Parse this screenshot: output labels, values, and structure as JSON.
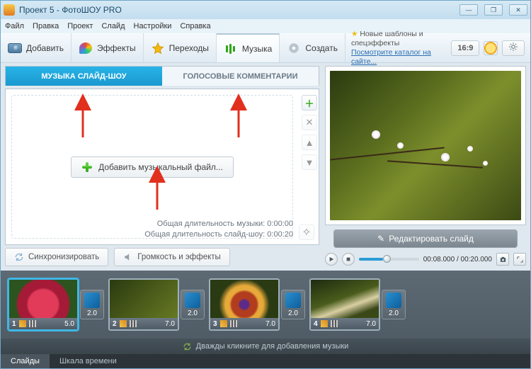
{
  "window": {
    "title": "Проект 5 - ФотоШОУ PRO"
  },
  "menu": {
    "file": "Файл",
    "edit": "Правка",
    "project": "Проект",
    "slide": "Слайд",
    "settings": "Настройки",
    "help": "Справка"
  },
  "toolbar": {
    "add": "Добавить",
    "effects": "Эффекты",
    "transitions": "Переходы",
    "music": "Музыка",
    "create": "Создать",
    "templates_line": "Новые шаблоны и спецэффекты",
    "templates_link": "Посмотрите каталог на сайте...",
    "aspect": "16:9"
  },
  "tabs": {
    "music": "МУЗЫКА СЛАЙД-ШОУ",
    "voice": "ГОЛОСОВЫЕ КОММЕНТАРИИ"
  },
  "panel": {
    "add_music": "Добавить музыкальный файл...",
    "dur_music_label": "Общая длительность музыки:",
    "dur_music_val": "0:00:00",
    "dur_show_label": "Общая длительность слайд-шоу:",
    "dur_show_val": "0:00:20"
  },
  "buttons": {
    "sync": "Синхронизировать",
    "volume": "Громкость и эффекты",
    "edit_slide": "Редактировать слайд"
  },
  "playback": {
    "time": "00:08.000 / 00:20.000"
  },
  "timeline": {
    "hint": "Дважды кликните для добавления музыки",
    "slides_tab": "Слайды",
    "time_tab": "Шкала времени",
    "clips": [
      {
        "n": "1",
        "dur": "5.0",
        "trans": "2.0",
        "bg": "radial-gradient(circle at 50% 50%,#e23b5a 0 35%,#a51b37 40% 60%,#2c541e 65% 100%)"
      },
      {
        "n": "2",
        "dur": "7.0",
        "trans": "2.0",
        "bg": "linear-gradient(135deg,#2b3a10,#6d8025)"
      },
      {
        "n": "3",
        "dur": "7.0",
        "trans": "2.0",
        "bg": "radial-gradient(circle at 50% 50%,#5b2a8a 0 10%,#b23d1e 15% 30%,#e6a93a 35% 45%,#2a3a12 60% 100%)"
      },
      {
        "n": "4",
        "dur": "7.0",
        "trans": "2.0",
        "bg": "linear-gradient(160deg,#1e2a10,#4a5c1c 40%,#d9cfa3 55%,#3a4818 70%)"
      }
    ]
  }
}
